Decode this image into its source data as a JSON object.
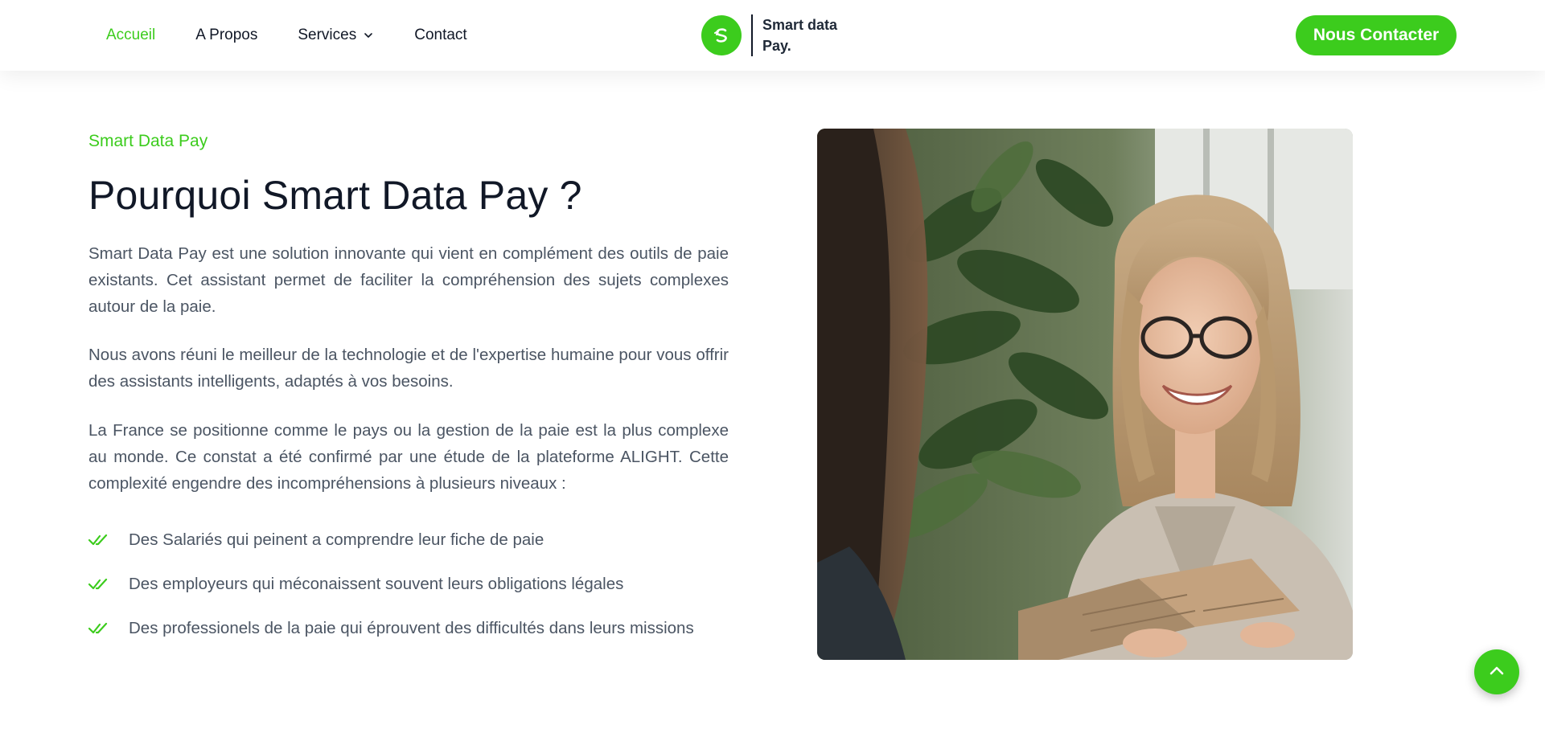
{
  "nav": {
    "items": [
      {
        "label": "Accueil",
        "active": true
      },
      {
        "label": "A Propos",
        "active": false
      },
      {
        "label": "Services",
        "active": false,
        "has_dropdown": true
      },
      {
        "label": "Contact",
        "active": false
      }
    ]
  },
  "brand": {
    "name": "Smart data Pay.",
    "logo_icon": "dollar-swirl-icon"
  },
  "cta": {
    "label": "Nous Contacter"
  },
  "section": {
    "eyebrow": "Smart Data Pay",
    "title": "Pourquoi Smart Data Pay ?",
    "paragraphs": [
      "Smart Data Pay est une solution innovante qui vient en complément des outils de paie existants. Cet assistant permet de faciliter la compréhension des sujets complexes autour de la paie.",
      "Nous avons réuni le meilleur de la technologie et de l'expertise humaine pour vous offrir des assistants intelligents, adaptés à vos besoins.",
      "La France se positionne comme le pays ou la gestion de la paie est la plus complexe au monde. Ce constat a été confirmé par une étude de la plateforme ALIGHT. Cette complexité engendre des incompréhensions à plusieurs niveaux :"
    ],
    "bullets": [
      "Des Salariés qui peinent a comprendre leur fiche de paie",
      "Des employeurs qui méconaissent souvent leurs obligations légales",
      "Des professionels de la paie qui éprouvent des difficultés dans leurs missions"
    ]
  },
  "colors": {
    "accent": "#3ccc1d",
    "text_dark": "#111827",
    "text_body": "#4b5563"
  },
  "icons": {
    "bullet": "double-check-icon",
    "scroll_top": "chevron-up-icon",
    "dropdown": "chevron-down-icon"
  }
}
